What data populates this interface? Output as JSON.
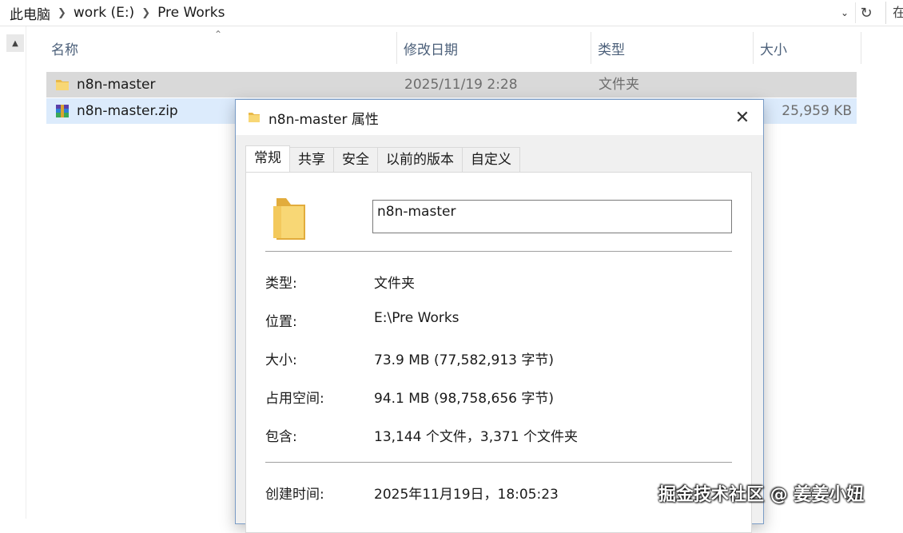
{
  "address_bar": {
    "breadcrumbs": [
      "此电脑",
      "work (E:)",
      "Pre Works"
    ],
    "dropdown_icon": "chevron-down-icon",
    "refresh_icon": "refresh-icon",
    "search_glyph": "在"
  },
  "columns": {
    "name": "名称",
    "date": "修改日期",
    "type": "类型",
    "size": "大小"
  },
  "files": [
    {
      "name": "n8n-master",
      "date": "2025/11/19 2:28",
      "type": "文件夹",
      "size": "",
      "icon": "folder-icon"
    },
    {
      "name": "n8n-master.zip",
      "date": "",
      "type": "",
      "size": "25,959 KB",
      "icon": "zip-archive-icon"
    }
  ],
  "dialog": {
    "title": "n8n-master 属性",
    "tabs": [
      "常规",
      "共享",
      "安全",
      "以前的版本",
      "自定义"
    ],
    "active_tab": "常规",
    "name_value": "n8n-master",
    "properties": {
      "type_label": "类型:",
      "type_value": "文件夹",
      "location_label": "位置:",
      "location_value": "E:\\Pre Works",
      "size_label": "大小:",
      "size_value": "73.9 MB (77,582,913 字节)",
      "disk_label": "占用空间:",
      "disk_value": "94.1 MB (98,758,656 字节)",
      "contains_label": "包含:",
      "contains_value": "13,144 个文件，3,371 个文件夹",
      "created_label": "创建时间:",
      "created_value": "2025年11月19日，18:05:23"
    }
  },
  "watermark": "掘金技术社区 @ 姜姜小妞",
  "colors": {
    "selected_row_gray": "#d9d9d9",
    "selected_row_blue": "#dcebfc",
    "header_text": "#4c607a",
    "folder_yellow": "#f8d775"
  }
}
